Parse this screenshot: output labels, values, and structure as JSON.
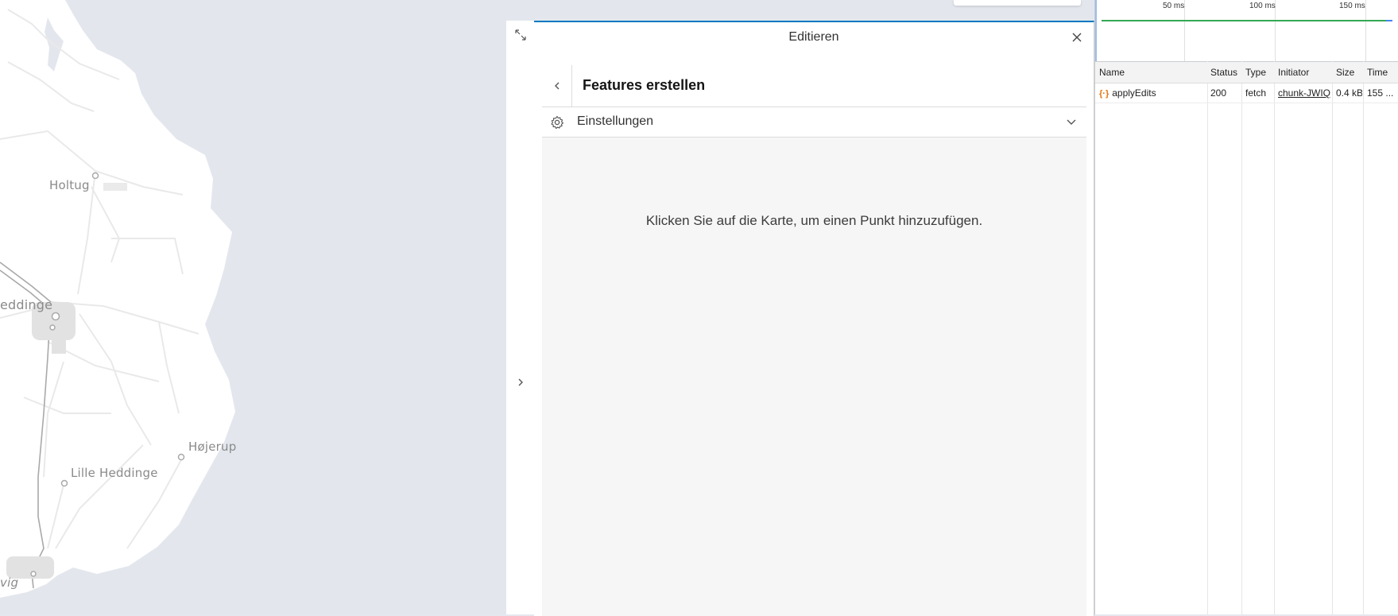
{
  "map": {
    "places": [
      "Holtug",
      "eddinge",
      "Højerup",
      "Lille Heddinge",
      "vig"
    ]
  },
  "editor": {
    "title": "Editieren",
    "flow_title": "Features erstellen",
    "settings_label": "Einstellungen",
    "hint": "Klicken Sie auf die Karte, um einen Punkt hinzuzufügen."
  },
  "devtools": {
    "timeline_ticks": [
      "50 ms",
      "100 ms",
      "150 ms"
    ],
    "columns": [
      "Name",
      "Status",
      "Type",
      "Initiator",
      "Size",
      "Time"
    ],
    "rows": [
      {
        "name": "applyEdits",
        "status": "200",
        "type": "fetch",
        "initiator": "chunk-JWIQI",
        "size": "0.4 kB",
        "time": "155 ..."
      }
    ]
  },
  "colors": {
    "accent": "#0079c1",
    "map_land": "#ffffff",
    "map_water": "#e3e7ed",
    "timeline_green": "#34a853",
    "request_icon": "#e8710a"
  }
}
